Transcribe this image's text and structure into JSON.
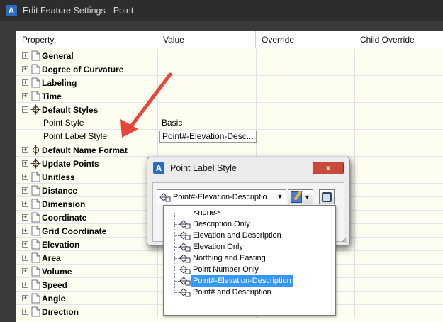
{
  "window": {
    "title": "Edit Feature Settings - Point",
    "logo_letter": "A"
  },
  "grid": {
    "headers": [
      "Property",
      "Value",
      "Override",
      "Child Override"
    ],
    "rows": [
      {
        "name": "General",
        "type": "page",
        "expanded": false
      },
      {
        "name": "Degree of Curvature",
        "type": "page",
        "expanded": false
      },
      {
        "name": "Labeling",
        "type": "page",
        "expanded": false
      },
      {
        "name": "Time",
        "type": "page",
        "expanded": false
      },
      {
        "name": "Default Styles",
        "type": "target",
        "expanded": true
      },
      {
        "child": "Point Style",
        "value": "Basic"
      },
      {
        "child": "Point Label Style",
        "value": "Point#-Elevation-Desc..."
      },
      {
        "name": "Default Name Format",
        "type": "target",
        "expanded": false
      },
      {
        "name": "Update Points",
        "type": "target",
        "expanded": false
      },
      {
        "name": "Unitless",
        "type": "page",
        "expanded": false
      },
      {
        "name": "Distance",
        "type": "page",
        "expanded": false
      },
      {
        "name": "Dimension",
        "type": "page",
        "expanded": false
      },
      {
        "name": "Coordinate",
        "type": "page",
        "expanded": false
      },
      {
        "name": "Grid Coordinate",
        "type": "page",
        "expanded": false
      },
      {
        "name": "Elevation",
        "type": "page",
        "expanded": false
      },
      {
        "name": "Area",
        "type": "page",
        "expanded": false
      },
      {
        "name": "Volume",
        "type": "page",
        "expanded": false
      },
      {
        "name": "Speed",
        "type": "page",
        "expanded": false
      },
      {
        "name": "Angle",
        "type": "page",
        "expanded": false
      },
      {
        "name": "Direction",
        "type": "page",
        "expanded": false
      }
    ]
  },
  "dialog": {
    "title": "Point Label Style",
    "logo_letter": "A",
    "close_label": "x",
    "combo_value": "Point#-Elevation-Descriptio",
    "options": [
      "<none>",
      "Description Only",
      "Elevation and Description",
      "Elevation Only",
      "Northing and Easting",
      "Point Number Only",
      "Point#-Elevation-Description",
      "Point# and Description"
    ],
    "selected_index": 6
  },
  "colors": {
    "selection": "#3399ff",
    "arrow": "#e8443a",
    "panel_bg": "#fefef0",
    "title_bg": "#2d2d2d"
  },
  "icons": {
    "page": "page-icon",
    "target": "crosshair-target-icon",
    "style": "label-style-icon",
    "edit": "edit-style-icon",
    "browse": "browse-icon"
  }
}
